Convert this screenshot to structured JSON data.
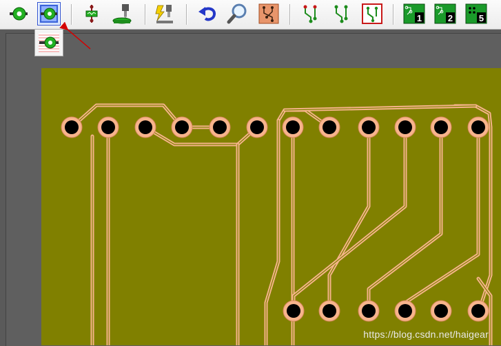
{
  "toolbar": {
    "buttons": [
      {
        "id": "place-pad",
        "icon": "pad-place-icon"
      },
      {
        "id": "pad-stack",
        "icon": "pad-stack-icon",
        "active": true
      },
      {
        "id": "place-via",
        "icon": "via-component-icon"
      },
      {
        "id": "drill-holes",
        "icon": "drill-machine-icon"
      },
      {
        "id": "drc-check",
        "icon": "lightning-check-icon"
      },
      {
        "id": "undo",
        "icon": "undo-arrow-icon"
      },
      {
        "id": "zoom",
        "icon": "magnifier-icon"
      },
      {
        "id": "board-view",
        "icon": "board-traces-icon"
      },
      {
        "id": "route-1",
        "icon": "route-traces-icon"
      },
      {
        "id": "route-2",
        "icon": "route-traces-alt-icon"
      },
      {
        "id": "route-3",
        "icon": "route-traces-framed-icon"
      },
      {
        "id": "layer-1",
        "icon": "layer-board-icon",
        "label": "1"
      },
      {
        "id": "layer-2",
        "icon": "layer-board-icon",
        "label": "2"
      },
      {
        "id": "layer-5",
        "icon": "layer-board-icon",
        "label": "5"
      }
    ]
  },
  "flyout": {
    "icon": "pad-hatched-icon"
  },
  "colors": {
    "board": "#808000",
    "trace": "#f7b48c",
    "pad_ring": "#f7b48c",
    "hole": "#000000",
    "active_border": "#2b4fd0",
    "arrow": "#d40000"
  },
  "watermark": "https://blog.csdn.net/haigear"
}
